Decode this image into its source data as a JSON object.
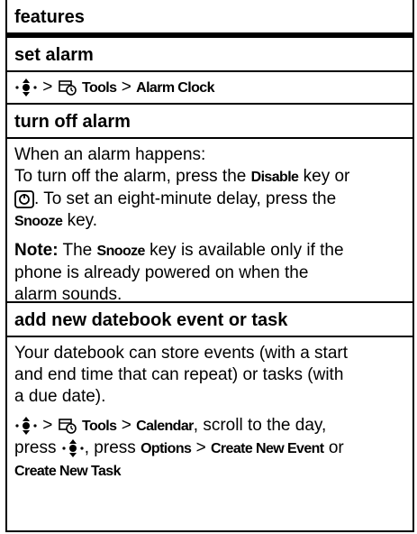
{
  "header": "features",
  "sections": {
    "set_alarm": {
      "title": "set alarm",
      "gt1": ">",
      "tools": "Tools",
      "gt2": ">",
      "alarm_clock": "Alarm Clock"
    },
    "turn_off": {
      "title": "turn off alarm",
      "l1": "When an alarm happens:",
      "l2a": "To turn off the alarm, press the ",
      "disable": "Disable",
      "l2b": " key or",
      "l3": ". To set an eight-minute delay, press the",
      "snooze1": "Snooze",
      "l4": " key.",
      "note_label": "Note:",
      "note_a": " The ",
      "snooze2": "Snooze",
      "note_b": " key is available only if the",
      "note_l2": "phone is already powered on when the",
      "note_l3": "alarm sounds."
    },
    "datebook": {
      "title": "add new datebook event or task",
      "d1": "Your datebook can store events (with a start",
      "d2": "and end time that can repeat) or tasks (with",
      "d3": "a due date).",
      "gt1": ">",
      "tools": "Tools",
      "gt2": ">",
      "calendar": "Calendar",
      "scroll": ", scroll to the day,",
      "press": "press ",
      "press2": ", press ",
      "options": "Options",
      "gt3": " > ",
      "create_event": "Create New Event",
      "or": " or",
      "create_task": "Create New Task"
    }
  }
}
